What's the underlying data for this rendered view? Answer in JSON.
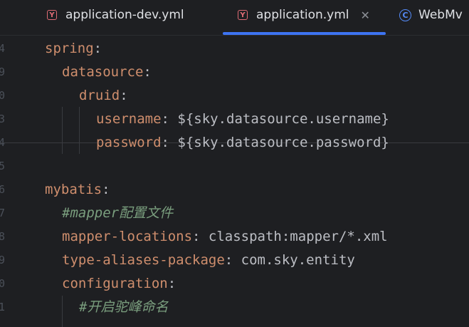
{
  "tabs": [
    {
      "label": "application-dev.yml",
      "icon": "yaml-file-icon",
      "icon_glyph": "Y"
    },
    {
      "label": "application.yml",
      "icon": "yaml-file-icon",
      "icon_glyph": "Y",
      "close_glyph": "✕",
      "active": true
    },
    {
      "label": "WebMv",
      "icon": "class-icon",
      "icon_glyph": "C"
    }
  ],
  "gutter": [
    "4",
    "9",
    "0",
    "3",
    "4",
    "5",
    "6",
    "7",
    "8",
    "9",
    "0",
    "1"
  ],
  "code": {
    "l1": {
      "key": "spring",
      "sep": ":"
    },
    "l2": {
      "key": "datasource",
      "sep": ":"
    },
    "l3": {
      "key": "druid",
      "sep": ":"
    },
    "l4": {
      "key": "username",
      "sep": ": ",
      "value": "${sky.datasource.username}"
    },
    "l5": {
      "key": "password",
      "sep": ": ",
      "value": "${sky.datasource.password}"
    },
    "l7": {
      "key": "mybatis",
      "sep": ":"
    },
    "l8": {
      "comment": "#mapper配置文件"
    },
    "l9": {
      "key": "mapper-locations",
      "sep": ": ",
      "value": "classpath:mapper/*.xml"
    },
    "l10": {
      "key": "type-aliases-package",
      "sep": ": ",
      "value": "com.sky.entity"
    },
    "l11": {
      "key": "configuration",
      "sep": ":"
    },
    "l12": {
      "comment": "#开启驼峰命名"
    }
  },
  "colors": {
    "background": "#1e1f22",
    "key": "#cf8e6d",
    "text": "#bcbec4",
    "comment": "#7a9e7e",
    "accent": "#3d74f2"
  }
}
